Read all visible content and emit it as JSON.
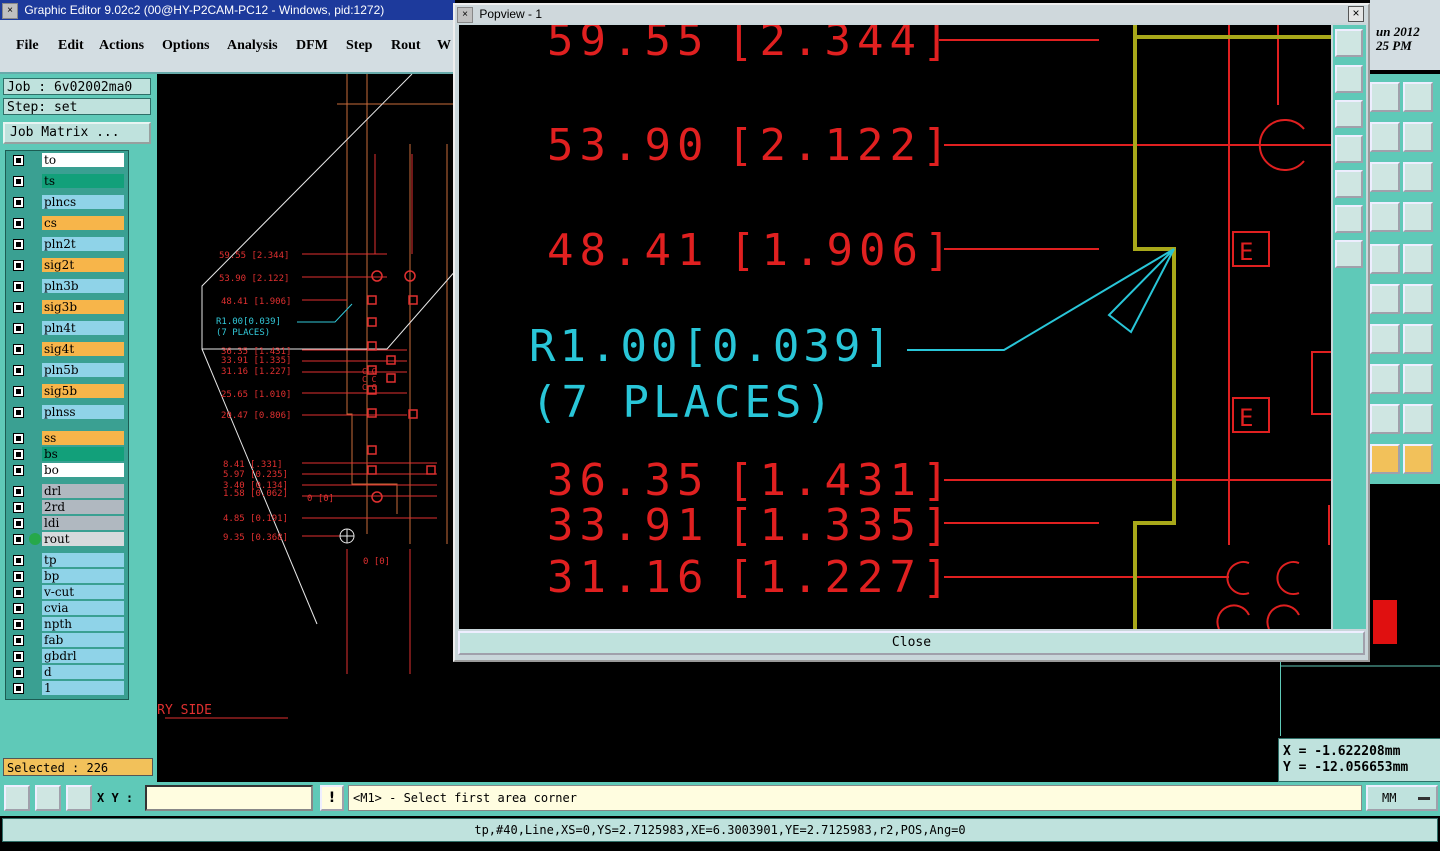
{
  "window": {
    "title": "Graphic Editor 9.02c2 (00@HY-P2CAM-PC12 - Windows, pid:1272)",
    "close_glyph": "×"
  },
  "menu": [
    "File",
    "Edit",
    "Actions",
    "Options",
    "Analysis",
    "DFM",
    "Step",
    "Rout",
    "W"
  ],
  "job": {
    "job_text": "Job : 6v02002ma0",
    "step_text": "Step: set",
    "matrix_button": "Job Matrix ..."
  },
  "layers": [
    {
      "name": "to",
      "color": "#ffffff"
    },
    {
      "name": "ts",
      "color": "#12a07a"
    },
    {
      "name": "plncs",
      "color": "#8fd3e8"
    },
    {
      "name": "cs",
      "color": "#f7b54a"
    },
    {
      "name": "pln2t",
      "color": "#8fd3e8"
    },
    {
      "name": "sig2t",
      "color": "#f7b54a"
    },
    {
      "name": "pln3b",
      "color": "#8fd3e8"
    },
    {
      "name": "sig3b",
      "color": "#f7b54a"
    },
    {
      "name": "pln4t",
      "color": "#8fd3e8"
    },
    {
      "name": "sig4t",
      "color": "#f7b54a"
    },
    {
      "name": "pln5b",
      "color": "#8fd3e8"
    },
    {
      "name": "sig5b",
      "color": "#f7b54a"
    },
    {
      "name": "plnss",
      "color": "#8fd3e8"
    },
    {
      "name": "ss",
      "color": "#f7b54a"
    },
    {
      "name": "bs",
      "color": "#12a07a"
    },
    {
      "name": "bo",
      "color": "#ffffff"
    },
    {
      "name": "drl",
      "color": "#b0b8c0"
    },
    {
      "name": "2rd",
      "color": "#b0b8c0"
    },
    {
      "name": "ldi",
      "color": "#b0b8c0"
    },
    {
      "name": "rout",
      "color": "#d6dadc",
      "active": true
    },
    {
      "name": "tp",
      "color": "#8fd3e8"
    },
    {
      "name": "bp",
      "color": "#8fd3e8"
    },
    {
      "name": "v-cut",
      "color": "#8fd3e8"
    },
    {
      "name": "cvia",
      "color": "#8fd3e8"
    },
    {
      "name": "npth",
      "color": "#8fd3e8"
    },
    {
      "name": "fab",
      "color": "#8fd3e8"
    },
    {
      "name": "gbdrl",
      "color": "#8fd3e8"
    },
    {
      "name": "d",
      "color": "#8fd3e8"
    },
    {
      "name": "1",
      "color": "#8fd3e8"
    }
  ],
  "selected": "Selected : 226",
  "clock": {
    "date": "un 2012",
    "time": "25 PM"
  },
  "coords": {
    "x": "X = -1.622208mm",
    "y": "Y = -12.056653mm"
  },
  "popview": {
    "title": "Popview - 1",
    "close_x": "×",
    "close_button": "Close",
    "dims": [
      {
        "value": "59.55",
        "inch": "[2.344]"
      },
      {
        "value": "53.90",
        "inch": "[2.122]"
      },
      {
        "value": "48.41",
        "inch": "[1.906]"
      },
      {
        "value": "36.35",
        "inch": "[1.431]"
      },
      {
        "value": "33.91",
        "inch": "[1.335]"
      },
      {
        "value": "31.16",
        "inch": "[1.227]"
      }
    ],
    "note_line1": "R1.00[0.039]",
    "note_line2": "(7 PLACES)",
    "marker": "E"
  },
  "canvas": {
    "left_dims": [
      "59.55 [2.344]",
      "53.90 [2.122]",
      "48.41 [1.906]",
      "36.35 [1.431]",
      "33.91 [1.335]",
      "31.16 [1.227]",
      "25.65 [1.010]",
      "20.47 [0.806]",
      "8.41 [.331]",
      "5.97 [0.235]",
      "3.40 [0.134]",
      "1.58 [0.062]",
      "4.85 [0.191]",
      "9.35 [0.368]"
    ],
    "note1": "R1.00[0.039]",
    "note2": "(7 PLACES)",
    "zero": "0 [0]",
    "primary_side": "PRIMARY SIDE"
  },
  "bottom": {
    "xy_label": "X Y :",
    "xy_value": "",
    "alert": "!",
    "prompt": "<M1> - Select first area corner",
    "units": "MM"
  },
  "status": "tp,#40,Line,XS=0,YS=2.7125983,XE=6.3003901,YE=2.7125983,r2,POS,Ang=0"
}
